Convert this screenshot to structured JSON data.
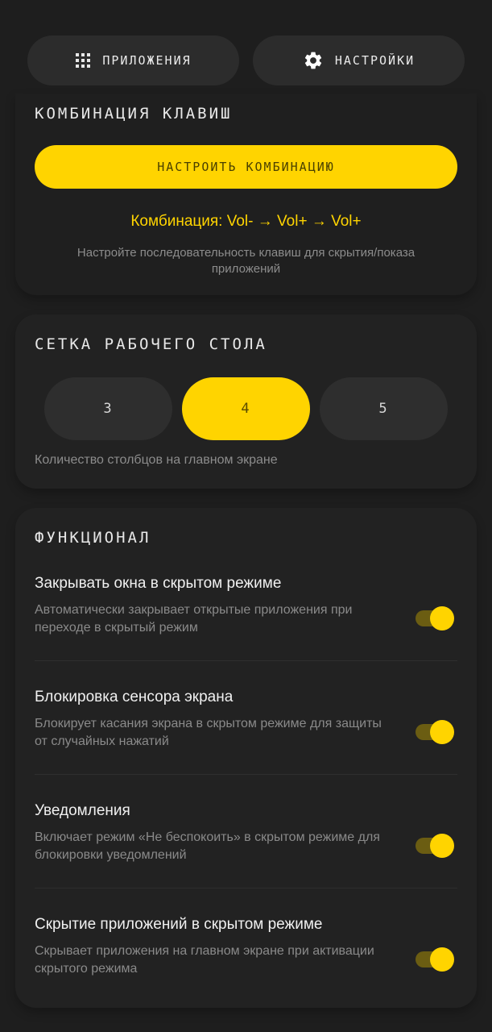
{
  "nav": {
    "apps_label": "ПРИЛОЖЕНИЯ",
    "settings_label": "НАСТРОЙКИ",
    "apps_icon": "grid-dots-icon",
    "settings_icon": "gear-icon"
  },
  "shortcut": {
    "title": "КОМБИНАЦИЯ КЛАВИШ",
    "button_label": "НАСТРОИТЬ КОМБИНАЦИЮ",
    "combo": "Комбинация: Vol- → Vol+ → Vol+",
    "hint": "Настройте последовательность клавиш для скрытия/показа приложений"
  },
  "grid": {
    "title": "СЕТКА РАБОЧЕГО СТОЛА",
    "options": [
      "3",
      "4",
      "5"
    ],
    "selected": "4",
    "description": "Количество столбцов на главном экране"
  },
  "features": {
    "title": "ФУНКЦИОНАЛ",
    "items": [
      {
        "title": "Закрывать окна в скрытом режиме",
        "description": "Автоматически закрывает открытые приложения при переходе в скрытый режим",
        "enabled": true
      },
      {
        "title": "Блокировка сенсора экрана",
        "description": "Блокирует касания экрана в скрытом режиме для защиты от случайных нажатий",
        "enabled": true
      },
      {
        "title": "Уведомления",
        "description": "Включает режим «Не беспокоить» в скрытом режиме для блокировки уведомлений",
        "enabled": true
      },
      {
        "title": "Скрытие приложений в скрытом режиме",
        "description": "Скрывает приложения на главном экране при активации скрытого режима",
        "enabled": true
      }
    ]
  },
  "colors": {
    "accent": "#ffd400",
    "background": "#1e1e1e",
    "card": "#222222"
  }
}
